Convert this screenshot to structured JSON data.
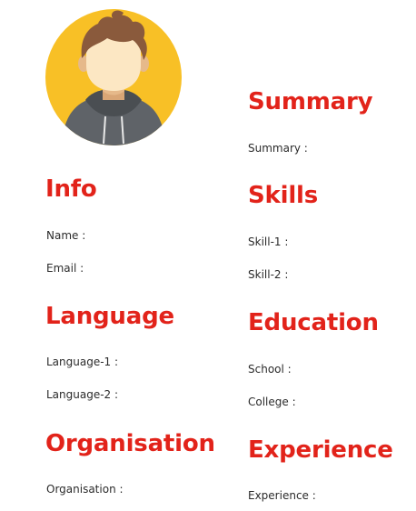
{
  "avatar": {
    "icon": "user-avatar-icon",
    "background": "#F8C026"
  },
  "left": {
    "info": {
      "title": "Info",
      "name_label": "Name :",
      "email_label": "Email :"
    },
    "language": {
      "title": "Language",
      "item1": "Language-1 :",
      "item2": "Language-2 :"
    },
    "organisation": {
      "title": "Organisation",
      "item1": "Organisation :"
    }
  },
  "right": {
    "summary": {
      "title": "Summary",
      "item1": "Summary :"
    },
    "skills": {
      "title": "Skills",
      "item1": "Skill-1 :",
      "item2": "Skill-2 :"
    },
    "education": {
      "title": "Education",
      "school": "School :",
      "college": "College :"
    },
    "experience": {
      "title": "Experience",
      "item1": "Experience :"
    }
  },
  "colors": {
    "heading": "#E2231A",
    "text": "#2B2B2B"
  }
}
